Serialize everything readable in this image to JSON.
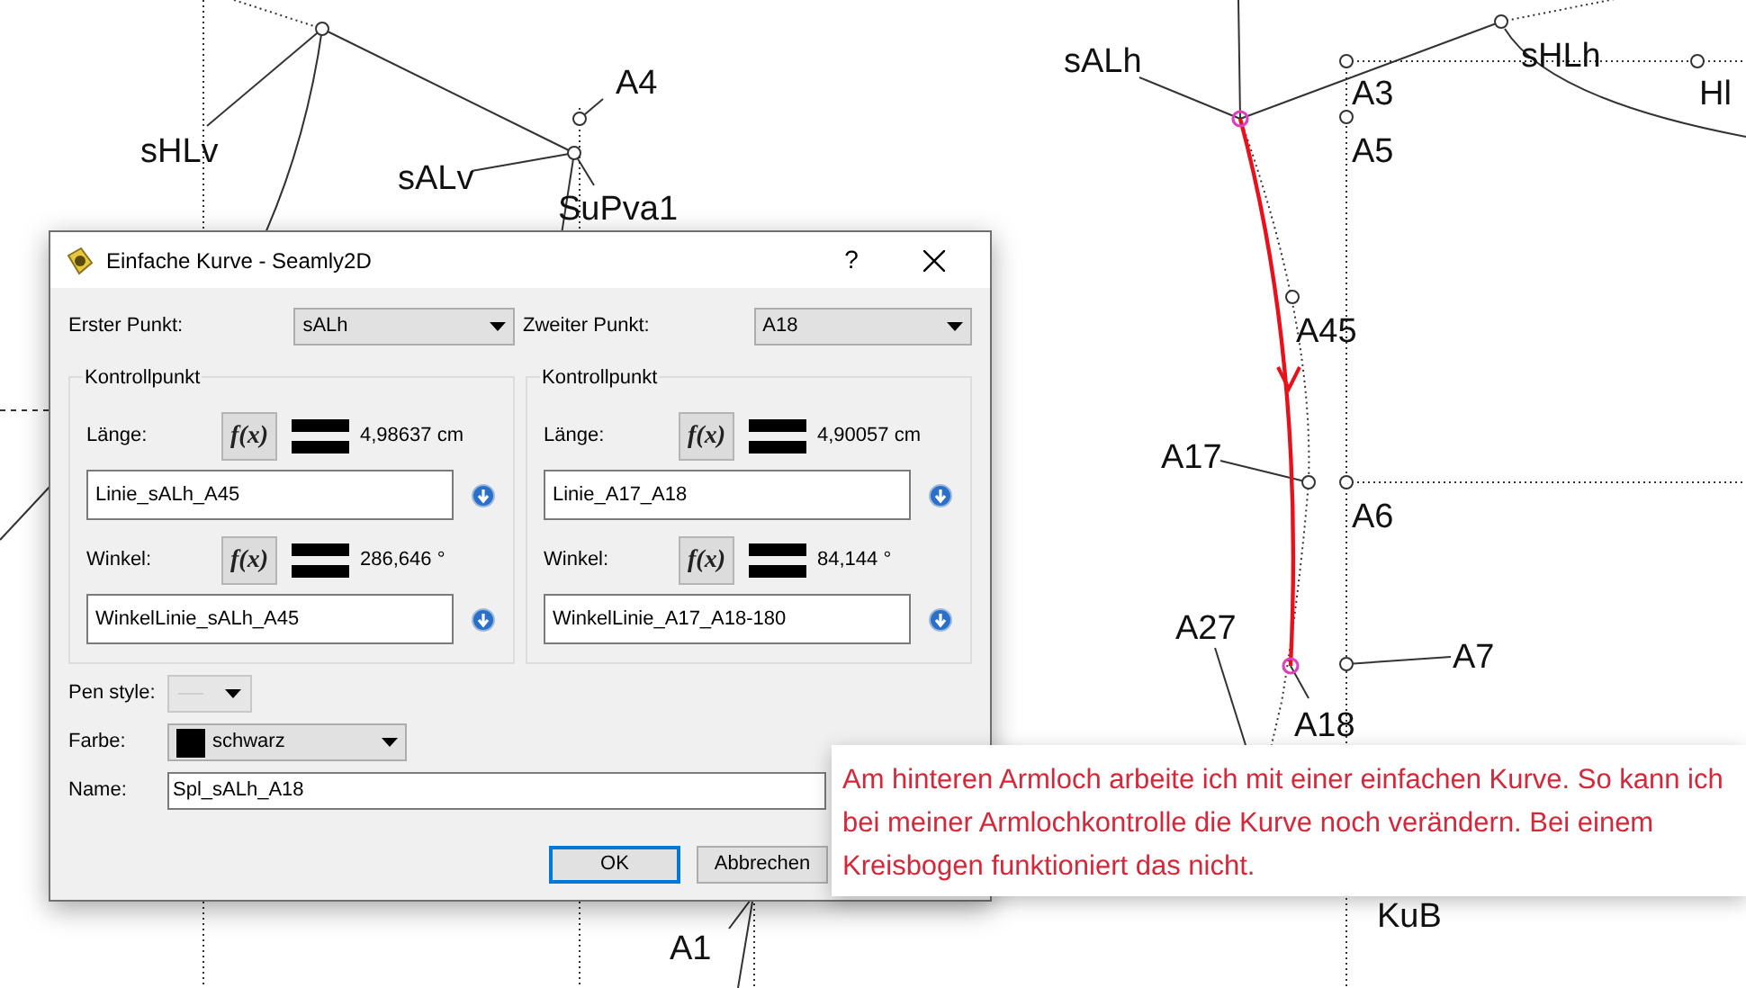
{
  "canvas": {
    "labels": [
      "sHLv",
      "sALv",
      "A4",
      "SuPva1",
      "sALh",
      "A3",
      "A5",
      "sHLh",
      "Hl",
      "A45",
      "A17",
      "A6",
      "A27",
      "A7",
      "A18",
      "A1",
      "KuB"
    ]
  },
  "dialog": {
    "title": "Einfache Kurve - Seamly2D",
    "help": "?",
    "first_point": {
      "label": "Erster Punkt:",
      "value": "sALh"
    },
    "second_point": {
      "label": "Zweiter Punkt:",
      "value": "A18"
    },
    "control_points": [
      {
        "title": "Kontrollpunkt",
        "length_label": "Länge:",
        "length_formula_button": "f(x)",
        "length_value": "4,98637 cm",
        "length_formula": "Linie_sALh_A45",
        "angle_label": "Winkel:",
        "angle_formula_button": "f(x)",
        "angle_value": "286,646 °",
        "angle_formula": "WinkelLinie_sALh_A45"
      },
      {
        "title": "Kontrollpunkt",
        "length_label": "Länge:",
        "length_formula_button": "f(x)",
        "length_value": "4,90057 cm",
        "length_formula": "Linie_A17_A18",
        "angle_label": "Winkel:",
        "angle_formula_button": "f(x)",
        "angle_value": "84,144 °",
        "angle_formula": "WinkelLinie_A17_A18-180"
      }
    ],
    "pen_style": {
      "label": "Pen style:"
    },
    "color": {
      "label": "Farbe:",
      "value": "schwarz",
      "color": "#000000"
    },
    "name": {
      "label": "Name:",
      "value": "Spl_sALh_A18"
    },
    "buttons": [
      {
        "label": "OK",
        "default": true
      },
      {
        "label": "Abbrechen",
        "default": false
      }
    ]
  },
  "callout": {
    "text": "Am hinteren Armloch arbeite ich mit einer einfachen Kurve. So kann ich bei meiner Armlochkontrolle die Kurve noch verändern. Bei einem Kreisbogen funktioniert das nicht."
  }
}
